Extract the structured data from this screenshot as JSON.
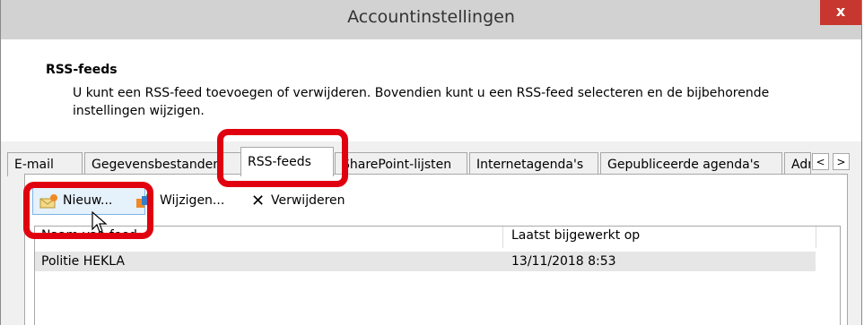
{
  "window": {
    "title": "Accountinstellingen",
    "close_label": "x"
  },
  "header": {
    "title": "RSS-feeds",
    "description": "U kunt een RSS-feed toevoegen of verwijderen. Bovendien kunt u een RSS-feed selecteren en de bijbehorende instellingen wijzigen."
  },
  "tabs": [
    {
      "label": "E-mail"
    },
    {
      "label": "Gegevensbestanden"
    },
    {
      "label": "RSS-feeds",
      "active": true
    },
    {
      "label": "SharePoint-lijsten"
    },
    {
      "label": "Internetagenda's"
    },
    {
      "label": "Gepubliceerde agenda's"
    },
    {
      "label": "Adresboeken"
    }
  ],
  "tab_scroll": {
    "left": "<",
    "right": ">"
  },
  "toolbar": {
    "new_label": "Nieuw...",
    "edit_label": "Wijzigen...",
    "delete_label": "Verwijderen"
  },
  "list": {
    "columns": [
      "Naam van feed",
      "Laatst bijgewerkt op"
    ],
    "rows": [
      {
        "name": "Politie HEKLA",
        "updated": "13/11/2018 8:53"
      }
    ]
  },
  "colors": {
    "highlight": "#e0000f",
    "titlebar": "#d2d2d2",
    "close": "#c7372f"
  }
}
